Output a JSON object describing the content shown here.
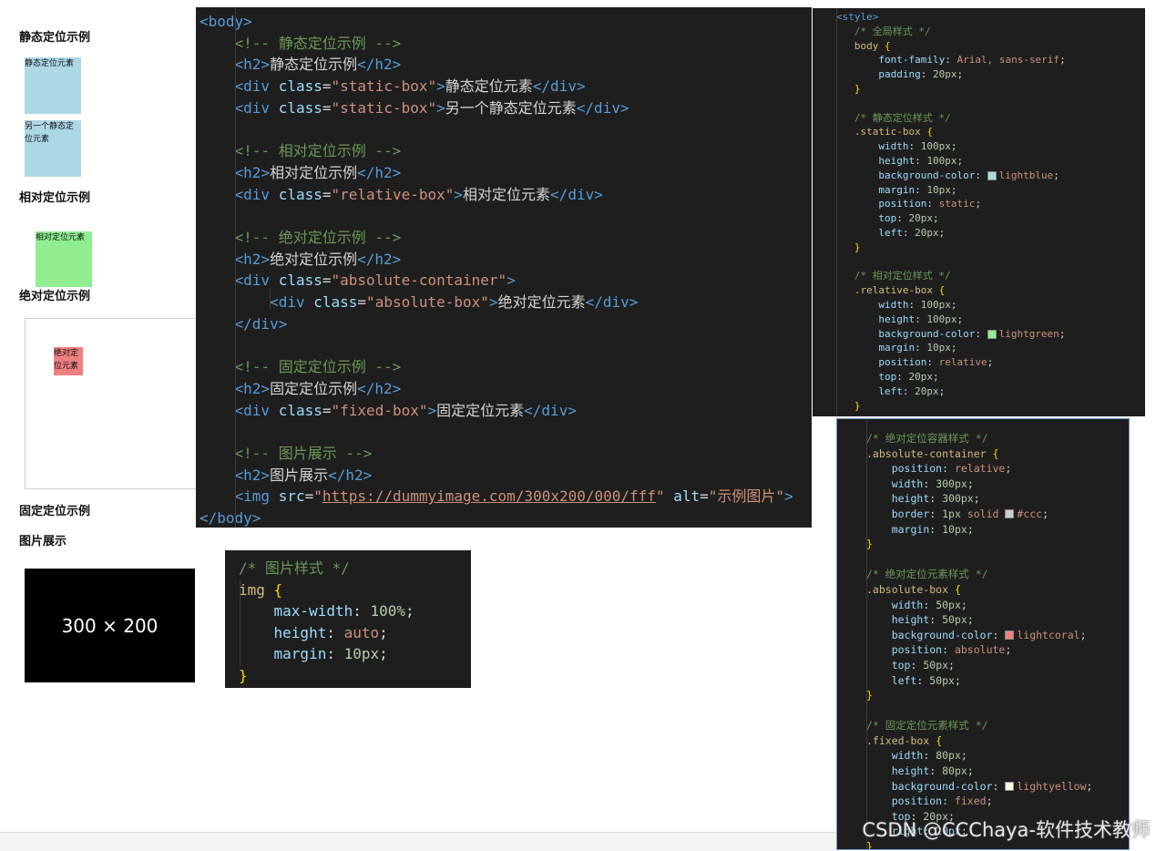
{
  "demo": {
    "static_heading": "静态定位示例",
    "static_box_1": "静态定位元素",
    "static_box_2": "另一个静态定位元素",
    "relative_heading": "相对定位示例",
    "relative_box": "相对定位元素",
    "absolute_heading": "绝对定位示例",
    "absolute_box": "绝对定位元素",
    "fixed_heading": "固定定位示例",
    "image_heading": "图片展示",
    "image_placeholder": "300 × 200"
  },
  "html_code": {
    "l1": "<body>",
    "l2": "<!-- 静态定位示例 -->",
    "l3_text": "静态定位示例",
    "l4_text": "静态定位元素",
    "l5_text": "另一个静态定位元素",
    "l7": "<!-- 相对定位示例 -->",
    "l8_text": "相对定位示例",
    "l9_text": "相对定位元素",
    "l11": "<!-- 绝对定位示例 -->",
    "l12_text": "绝对定位示例",
    "l14_text": "绝对定位元素",
    "l17": "<!-- 固定定位示例 -->",
    "l18_text": "固定定位示例",
    "l19_text": "固定定位元素",
    "l21": "<!-- 图片展示 -->",
    "l22_text": "图片展示",
    "img_src": "https://dummyimage.com/300x200/000/fff",
    "img_alt": "示例图片",
    "l24": "</body>",
    "cls_static": "static-box",
    "cls_relative": "relative-box",
    "cls_abs_container": "absolute-container",
    "cls_abs_box": "absolute-box",
    "cls_fixed": "fixed-box"
  },
  "style_code_1": {
    "open_tag": "<style>",
    "c_global": "/* 全局样式 */",
    "c_static": "/* 静态定位样式 */",
    "c_relative": "/* 相对定位样式 */",
    "font_family": "Arial, sans-serif",
    "lightblue": "lightblue",
    "lightgreen": "lightgreen"
  },
  "style_code_2": {
    "c_container": "/* 绝对定位容器样式 */",
    "c_absbox": "/* 绝对定位元素样式 */",
    "c_fixed": "/* 固定定位元素样式 */",
    "border_color": "#ccc",
    "lightcoral": "lightcoral",
    "lightyellow": "lightyellow",
    "partial": "right: 20px;"
  },
  "img_code": {
    "comment": "/* 图片样式 */",
    "selector": "img"
  },
  "watermark": "CSDN @CCChaya-软件技术教师",
  "colors": {
    "lightblue": "#add8e6",
    "lightgreen": "#90ee90",
    "lightcoral": "#f08080",
    "lightyellow": "#ffffe0",
    "editor_bg": "#1e1e1e"
  }
}
